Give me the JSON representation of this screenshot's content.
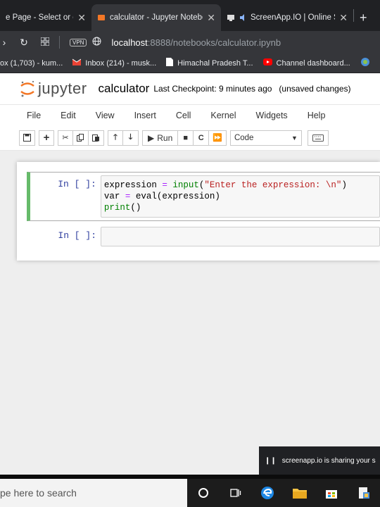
{
  "browser": {
    "tabs": [
      {
        "label": "e Page - Select or crea",
        "active": false
      },
      {
        "label": "calculator - Jupyter Notebo",
        "active": true
      },
      {
        "label": "ScreenApp.IO | Online S",
        "active": false
      }
    ],
    "new_tab_symbol": "+",
    "vpn_label": "VPN",
    "url_host": "localhost",
    "url_path": ":8888/notebooks/calculator.ipynb",
    "bookmarks": [
      {
        "label": "ox (1,703) - kum...",
        "icon": "mail-icon"
      },
      {
        "label": "Inbox (214) - musk...",
        "icon": "gmail-icon"
      },
      {
        "label": "Himachal Pradesh T...",
        "icon": "document-icon"
      },
      {
        "label": "Channel dashboard...",
        "icon": "youtube-icon"
      }
    ]
  },
  "jupyter": {
    "logo_text": "jupyter",
    "notebook_name": "calculator",
    "checkpoint": "Last Checkpoint: 9 minutes ago",
    "status": "(unsaved changes)",
    "menu": [
      "File",
      "Edit",
      "View",
      "Insert",
      "Cell",
      "Kernel",
      "Widgets",
      "Help"
    ],
    "toolbar": {
      "run_label": "Run",
      "cell_type": "Code"
    },
    "cells": [
      {
        "prompt": "In [ ]:",
        "lines": [
          "expression = input(\"Enter the expression: \\n\")",
          "var = eval(expression)",
          "print()"
        ]
      },
      {
        "prompt": "In [ ]:",
        "lines": []
      }
    ]
  },
  "notification": {
    "text": "screenapp.io is sharing your s"
  },
  "taskbar": {
    "search_placeholder": "pe here to search"
  },
  "colors": {
    "selected_cell_border": "#66bb6a",
    "jupyter_orange": "#f37726",
    "prompt_blue": "#303f9f"
  }
}
